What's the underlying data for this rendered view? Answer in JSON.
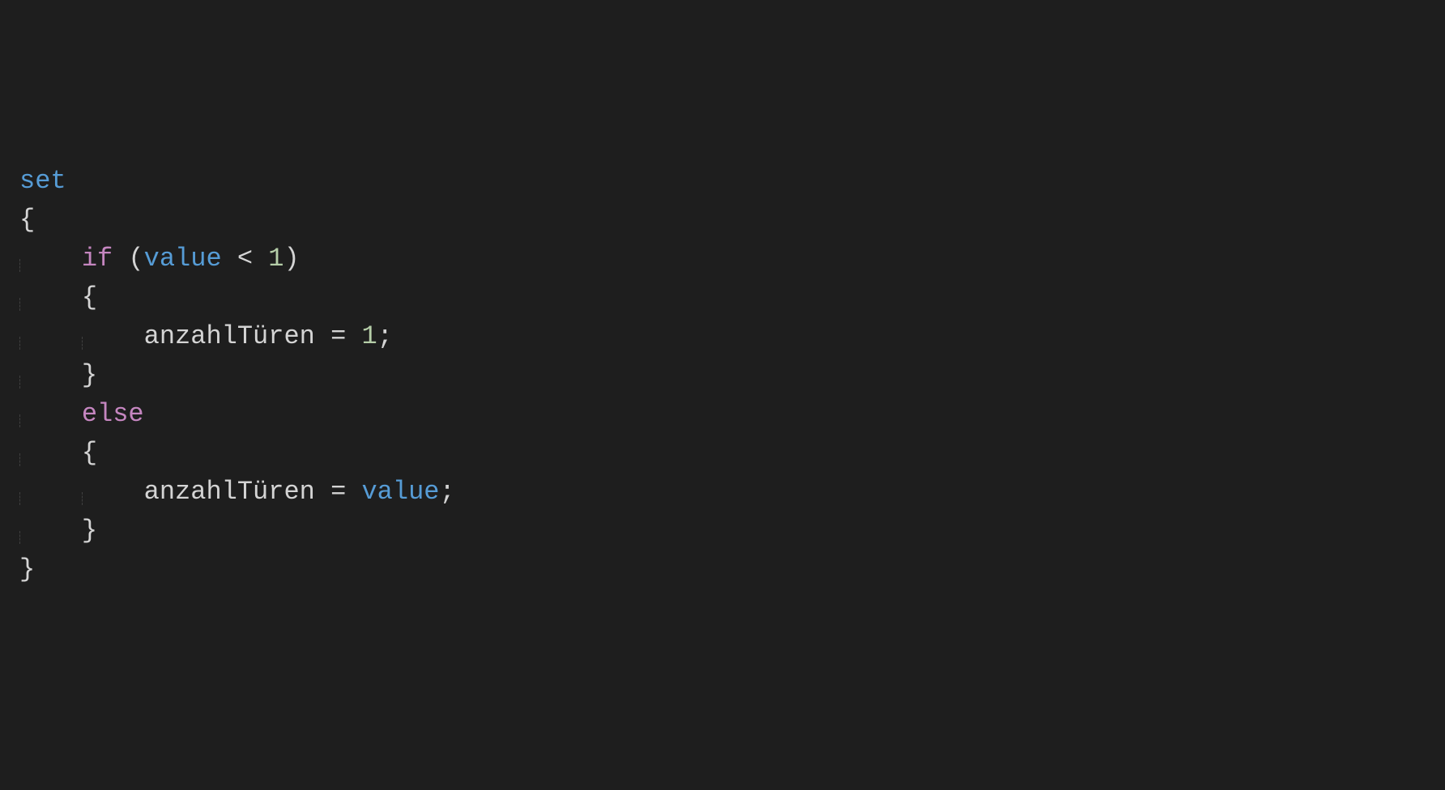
{
  "code": {
    "keyword_set": "set",
    "brace_open_outer": "{",
    "keyword_if": "if",
    "paren_open": "(",
    "value_kw_1": "value",
    "op_lt": "<",
    "num_1": "1",
    "paren_close": ")",
    "brace_open_if": "{",
    "ident_anzahl_1": "anzahlTüren",
    "op_assign_1": "=",
    "num_assign_1": "1",
    "semicolon_1": ";",
    "brace_close_if": "}",
    "keyword_else": "else",
    "brace_open_else": "{",
    "ident_anzahl_2": "anzahlTüren",
    "op_assign_2": "=",
    "value_kw_2": "value",
    "semicolon_2": ";",
    "brace_close_else": "}",
    "brace_close_outer": "}"
  }
}
